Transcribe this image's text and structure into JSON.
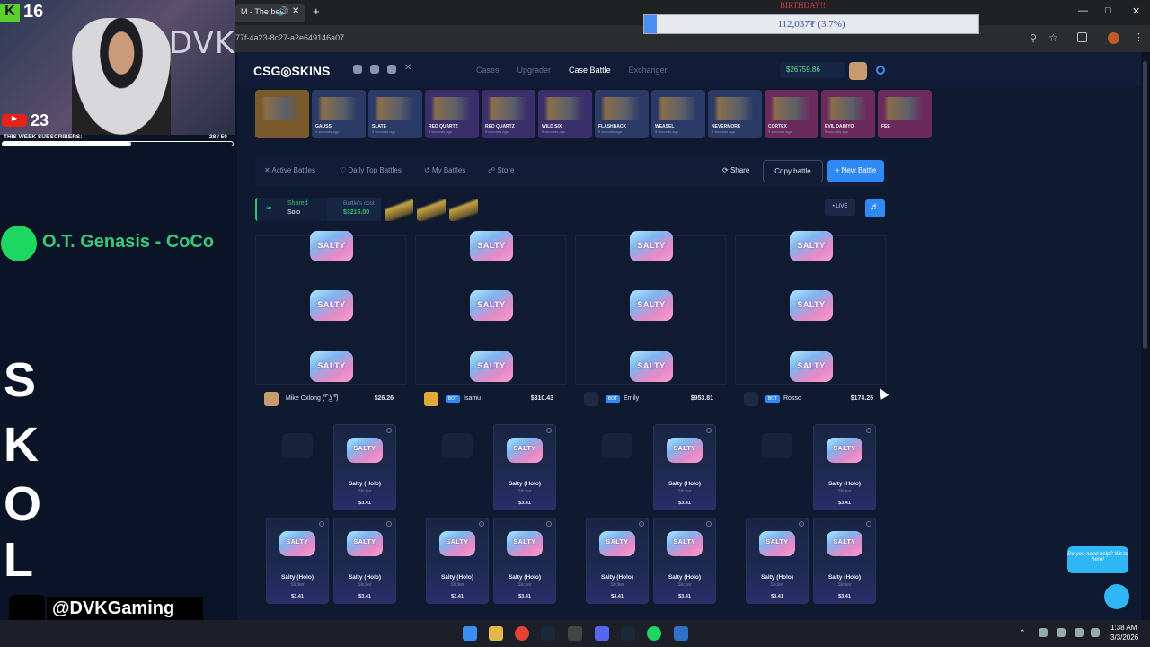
{
  "browser": {
    "tab_title": "M - The be",
    "url": "77f-4a23-8c27-a2e649146a07",
    "birthday_text": "BIRTHDAY!!!",
    "donation_text": "112,037₮ (3.7%)",
    "donation_progress": 0.037
  },
  "stream": {
    "kick_count": "16",
    "youtube_count": "23",
    "subs_label": "THIS WEEK SUBSCRIBERS:",
    "subs_value": "28 / 50",
    "subs_progress": 0.56,
    "cam_text": "DVK",
    "now_playing": "O.T. Genasis - CoCo",
    "letters": [
      "S",
      "K",
      "O",
      "L"
    ],
    "tiktok": "@DVKGaming"
  },
  "site": {
    "logo": "CSG◎SKINS",
    "nav": [
      "Cases",
      "Upgrader",
      "Case Battle",
      "Exchanger"
    ],
    "active_nav": "Case Battle",
    "balance": "$26759.86",
    "feed": [
      {
        "name": "",
        "ago": "",
        "color": "#7a5a2a"
      },
      {
        "name": "GAUSS",
        "ago": "4 seconds ago",
        "color": "#2b3a66"
      },
      {
        "name": "SLATE",
        "ago": "4 seconds ago",
        "color": "#2b3a66"
      },
      {
        "name": "RED QUARTZ",
        "ago": "5 seconds ago",
        "color": "#3a2f6a"
      },
      {
        "name": "RED QUARTZ",
        "ago": "5 seconds ago",
        "color": "#3a2f6a"
      },
      {
        "name": "WILD SIX",
        "ago": "5 seconds ago",
        "color": "#3a2f6a"
      },
      {
        "name": "FLASHBACK",
        "ago": "5 seconds ago",
        "color": "#2b3a66"
      },
      {
        "name": "WEASEL",
        "ago": "5 seconds ago",
        "color": "#2b3a66"
      },
      {
        "name": "NEVERMORE",
        "ago": "5 seconds ago",
        "color": "#2b3a66"
      },
      {
        "name": "CORTEX",
        "ago": "5 seconds ago",
        "color": "#6a2a5c"
      },
      {
        "name": "EVIL DAIMYO",
        "ago": "5 seconds ago",
        "color": "#6a2a5c"
      },
      {
        "name": "FEE",
        "ago": "",
        "color": "#6a2a5c"
      }
    ],
    "tabs": [
      "Active Battles",
      "Daily Top Battles",
      "My Battles",
      "Store"
    ],
    "share": "Share",
    "copy_battle": "Copy battle",
    "new_battle": "+ New Battle",
    "mode_top": "Shared",
    "mode_bottom": "Solo",
    "cost_label": "Battle's cost",
    "cost_value": "$3216.00",
    "live": "LIVE",
    "players": [
      {
        "name": "Mike Oxlong (͡° ͜ʖ ͡°)",
        "value": "$26.26",
        "bot": false,
        "avatar_color": "#c79b6e"
      },
      {
        "name": "Isamu",
        "value": "$310.43",
        "bot": true,
        "bot_label": "BOT",
        "avatar_color": "#e0a93a"
      },
      {
        "name": "Emily",
        "value": "$953.81",
        "bot": true,
        "bot_label": "BOT",
        "avatar_color": "#1d2a45"
      },
      {
        "name": "Rosso",
        "value": "$174.25",
        "bot": true,
        "bot_label": "BOT",
        "avatar_color": "#1d2a45"
      }
    ],
    "reel_label": "SALTY",
    "item_name": "Salty (Holo)",
    "item_rarity": "Sticker",
    "item_price": "$3.41",
    "help_text": "Do you need help? We're here!"
  },
  "taskbar": {
    "time": "1:38 AM",
    "date": "3/3/2026"
  }
}
